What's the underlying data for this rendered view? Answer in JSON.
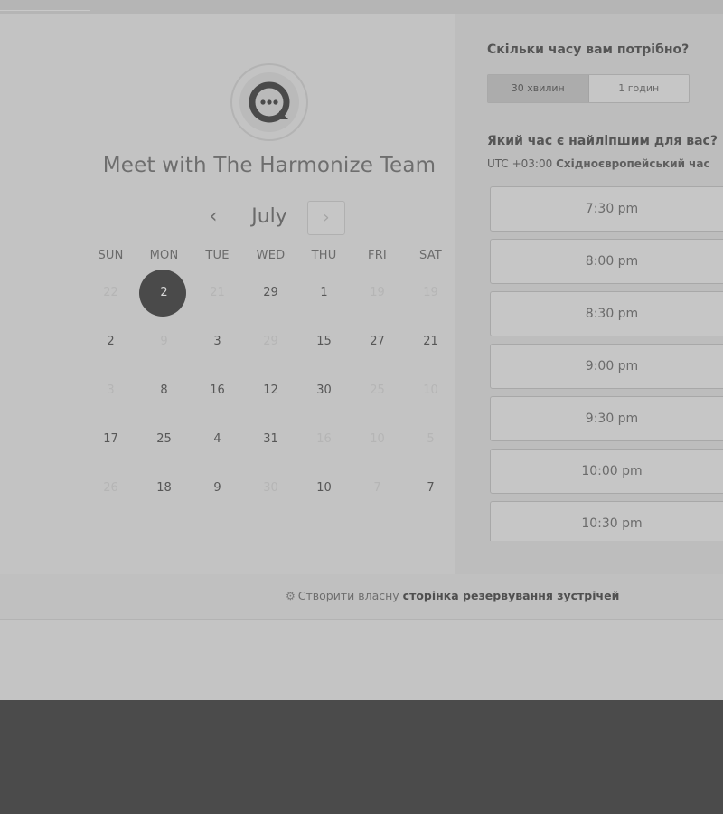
{
  "header": {
    "title": "Meet with The Harmonize Team"
  },
  "calendar": {
    "month": "July",
    "prev_symbol": "‹",
    "next_symbol": "›",
    "weekdays": [
      "SUN",
      "MON",
      "TUE",
      "WED",
      "THU",
      "FRI",
      "SAT"
    ],
    "weeks": [
      [
        {
          "label": "22",
          "state": "disabled"
        },
        {
          "label": "2",
          "state": "selected"
        },
        {
          "label": "21",
          "state": "disabled"
        },
        {
          "label": "29",
          "state": "enabled"
        },
        {
          "label": "1",
          "state": "enabled"
        },
        {
          "label": "19",
          "state": "disabled"
        },
        {
          "label": "19",
          "state": "disabled"
        }
      ],
      [
        {
          "label": "2",
          "state": "enabled"
        },
        {
          "label": "9",
          "state": "disabled"
        },
        {
          "label": "3",
          "state": "enabled"
        },
        {
          "label": "29",
          "state": "disabled"
        },
        {
          "label": "15",
          "state": "enabled"
        },
        {
          "label": "27",
          "state": "enabled"
        },
        {
          "label": "21",
          "state": "enabled"
        }
      ],
      [
        {
          "label": "3",
          "state": "disabled"
        },
        {
          "label": "8",
          "state": "enabled"
        },
        {
          "label": "16",
          "state": "enabled"
        },
        {
          "label": "12",
          "state": "enabled"
        },
        {
          "label": "30",
          "state": "enabled"
        },
        {
          "label": "25",
          "state": "disabled"
        },
        {
          "label": "10",
          "state": "disabled"
        }
      ],
      [
        {
          "label": "17",
          "state": "enabled"
        },
        {
          "label": "25",
          "state": "enabled"
        },
        {
          "label": "4",
          "state": "enabled"
        },
        {
          "label": "31",
          "state": "enabled"
        },
        {
          "label": "16",
          "state": "disabled"
        },
        {
          "label": "10",
          "state": "disabled"
        },
        {
          "label": "5",
          "state": "disabled"
        }
      ],
      [
        {
          "label": "26",
          "state": "disabled"
        },
        {
          "label": "18",
          "state": "enabled"
        },
        {
          "label": "9",
          "state": "enabled"
        },
        {
          "label": "30",
          "state": "disabled"
        },
        {
          "label": "10",
          "state": "enabled"
        },
        {
          "label": "7",
          "state": "disabled"
        },
        {
          "label": "7",
          "state": "enabled"
        }
      ]
    ]
  },
  "booking": {
    "duration_question": "Скільки часу вам потрібно?",
    "durations": [
      {
        "label": "30 хвилин",
        "active": true
      },
      {
        "label": "1 годин",
        "active": false
      }
    ],
    "time_question": "Який час є найліпшим для вас?",
    "timezone_offset": "UTC +03:00",
    "timezone_name": "Східноєвропейський час",
    "slots": [
      "7:30 pm",
      "8:00 pm",
      "8:30 pm",
      "9:00 pm",
      "9:30 pm",
      "10:00 pm",
      "10:30 pm"
    ]
  },
  "footer": {
    "link_prefix": "Створити власну",
    "link_bold": "сторінка резервування зустрічей"
  },
  "colors": {
    "overlay_dark": "#4b4b4b",
    "selected_day": "#4a4a4a"
  },
  "icons": {
    "logo": "chat-bubble-dots-icon",
    "footer": "sprocket-icon"
  }
}
